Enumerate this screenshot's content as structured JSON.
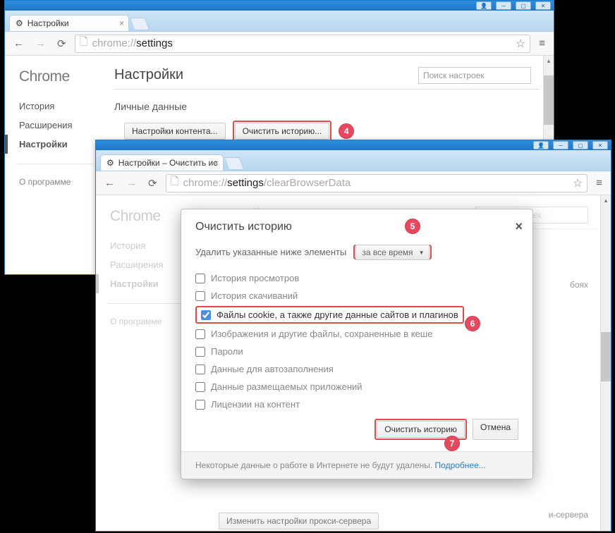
{
  "window1": {
    "titlebar_icons": {
      "user": "◣",
      "min": "─",
      "max": "▣",
      "close": "✕"
    },
    "tab": {
      "icon": "gear",
      "title": "Настройки"
    },
    "url_dim1": "chrome://",
    "url_dark": "settings",
    "sidebar": {
      "logo": "Chrome",
      "items": [
        "История",
        "Расширения",
        "Настройки"
      ],
      "active_index": 2,
      "about": "О программе"
    },
    "main": {
      "heading": "Настройки",
      "search_placeholder": "Поиск настроек",
      "section": "Личные данные",
      "btn_content": "Настройки контента...",
      "btn_clear": "Очистить историю..."
    }
  },
  "window2": {
    "tab": {
      "title": "Настройки – Очистить ис"
    },
    "url_dim1": "chrome://",
    "url_dark": "settings",
    "url_dim2": "/clearBrowserData",
    "sidebar": {
      "logo": "Chrome",
      "items": [
        "История",
        "Расширения",
        "Настройки"
      ],
      "active_index": 2,
      "about": "О программе"
    },
    "main": {
      "heading": "Настройки",
      "search_placeholder": "Поиск настроек",
      "ghost1": "бояx",
      "ghost2": "и-сервера",
      "below_btn": "Изменить настройки прокси-сервера"
    }
  },
  "dialog": {
    "title": "Очистить историю",
    "prompt": "Удалить указанные ниже элементы",
    "period": "за все время",
    "options": [
      {
        "label": "История просмотров",
        "checked": false
      },
      {
        "label": "История скачиваний",
        "checked": false
      },
      {
        "label": "Файлы cookie, а также другие данные сайтов и плагинов",
        "checked": true
      },
      {
        "label": "Изображения и другие файлы, сохраненные в кеше",
        "checked": false
      },
      {
        "label": "Пароли",
        "checked": false
      },
      {
        "label": "Данные для автозаполнения",
        "checked": false
      },
      {
        "label": "Данные размещаемых приложений",
        "checked": false
      },
      {
        "label": "Лицензии на контент",
        "checked": false
      }
    ],
    "btn_primary": "Очистить историю",
    "btn_cancel": "Отмена",
    "notice_text": "Некоторые данные о работе в Интернете не будут удалены. ",
    "notice_link": "Подробнее..."
  },
  "badges": {
    "b4": "4",
    "b5": "5",
    "b6": "6",
    "b7": "7"
  }
}
